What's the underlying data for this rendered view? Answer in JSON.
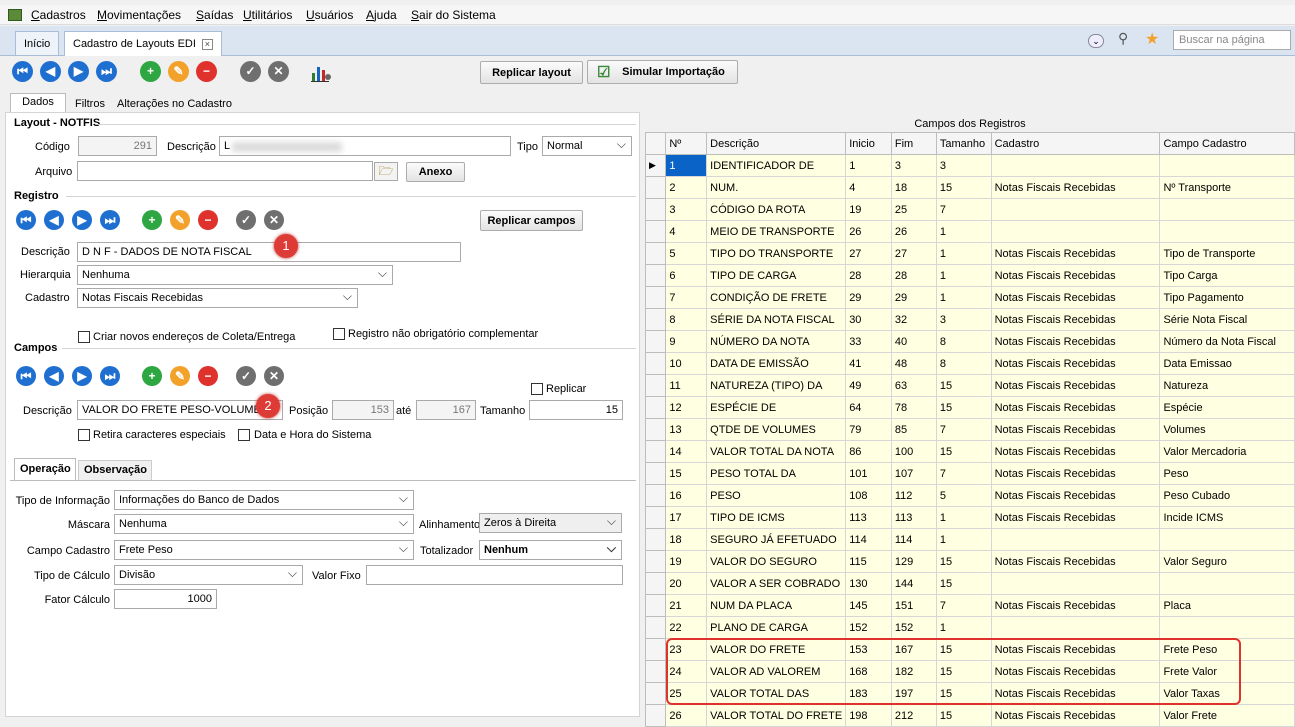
{
  "menu": [
    "Cadastros",
    "Movimentações",
    "Saídas",
    "Utilitários",
    "Usuários",
    "Ajuda",
    "Sair do Sistema"
  ],
  "tabs": {
    "home": "Início",
    "current": "Cadastro de Layouts EDI"
  },
  "search": {
    "placeholder": "Buscar na página"
  },
  "toolbar": {
    "replicar_layout": "Replicar layout",
    "simular": "Simular Importação"
  },
  "form_tabs": [
    "Dados",
    "Filtros",
    "Alterações no Cadastro"
  ],
  "layout": {
    "section": "Layout - NOTFIS",
    "codigo_label": "Código",
    "codigo": "291",
    "descricao_label": "Descrição",
    "descricao": "L",
    "tipo_label": "Tipo",
    "tipo": "Normal",
    "arquivo_label": "Arquivo",
    "arquivo": "",
    "anexo": "Anexo"
  },
  "registro": {
    "section": "Registro",
    "replicar": "Replicar campos",
    "descricao_label": "Descrição",
    "descricao": "D N F  - DADOS DE NOTA FISCAL",
    "hierarquia_label": "Hierarquia",
    "hierarquia": "Nenhuma",
    "cadastro_label": "Cadastro",
    "cadastro": "Notas Fiscais Recebidas",
    "chk1": "Criar novos endereços de Coleta/Entrega",
    "chk2": "Registro não obrigatório complementar"
  },
  "campos": {
    "section": "Campos",
    "replicar": "Replicar",
    "descricao_label": "Descrição",
    "descricao": "VALOR DO FRETE PESO-VOLUME",
    "posicao_label": "Posição",
    "posicao_ini": "153",
    "ate": "até",
    "posicao_fim": "167",
    "tamanho_label": "Tamanho",
    "tamanho": "15",
    "chk1": "Retira caracteres especiais",
    "chk2": "Data e Hora do Sistema"
  },
  "sub_tabs": [
    "Operação",
    "Observação"
  ],
  "operacao": {
    "tipo_info_label": "Tipo de Informação",
    "tipo_info": "Informações do Banco de Dados",
    "mascara_label": "Máscara",
    "mascara": "Nenhuma",
    "alinhamento_label": "Alinhamento",
    "alinhamento": "Zeros à Direita",
    "campo_cad_label": "Campo Cadastro",
    "campo_cad": "Frete Peso",
    "totalizador_label": "Totalizador",
    "totalizador": "Nenhum",
    "tipo_calc_label": "Tipo de Cálculo",
    "tipo_calc": "Divisão",
    "valor_fixo_label": "Valor Fixo",
    "valor_fixo": "",
    "fator_label": "Fator Cálculo",
    "fator": "1000"
  },
  "markers": [
    "1",
    "2"
  ],
  "grid": {
    "title": "Campos dos Registros",
    "headers": [
      "Nº",
      "Descrição",
      "Inicio",
      "Fim",
      "Tamanho",
      "Cadastro",
      "Campo Cadastro"
    ],
    "rows": [
      [
        "1",
        "IDENTIFICADOR DE",
        "1",
        "3",
        "3",
        "",
        ""
      ],
      [
        "2",
        "NUM.",
        "4",
        "18",
        "15",
        "Notas Fiscais Recebidas",
        "Nº Transporte"
      ],
      [
        "3",
        "CÓDIGO DA ROTA",
        "19",
        "25",
        "7",
        "",
        ""
      ],
      [
        "4",
        "MEIO DE TRANSPORTE",
        "26",
        "26",
        "1",
        "",
        ""
      ],
      [
        "5",
        "TIPO DO TRANSPORTE",
        "27",
        "27",
        "1",
        "Notas Fiscais Recebidas",
        "Tipo de Transporte"
      ],
      [
        "6",
        "TIPO DE CARGA",
        "28",
        "28",
        "1",
        "Notas Fiscais Recebidas",
        "Tipo Carga"
      ],
      [
        "7",
        "CONDIÇÃO DE FRETE",
        "29",
        "29",
        "1",
        "Notas Fiscais Recebidas",
        "Tipo Pagamento"
      ],
      [
        "8",
        "SÉRIE DA NOTA FISCAL",
        "30",
        "32",
        "3",
        "Notas Fiscais Recebidas",
        "Série Nota Fiscal"
      ],
      [
        "9",
        "NÚMERO DA NOTA",
        "33",
        "40",
        "8",
        "Notas Fiscais Recebidas",
        "Número da Nota Fiscal"
      ],
      [
        "10",
        "DATA DE EMISSÃO",
        "41",
        "48",
        "8",
        "Notas Fiscais Recebidas",
        "Data Emissao"
      ],
      [
        "11",
        "NATUREZA (TIPO) DA",
        "49",
        "63",
        "15",
        "Notas Fiscais Recebidas",
        "Natureza"
      ],
      [
        "12",
        "ESPÉCIE DE",
        "64",
        "78",
        "15",
        "Notas Fiscais Recebidas",
        "Espécie"
      ],
      [
        "13",
        "QTDE DE VOLUMES",
        "79",
        "85",
        "7",
        "Notas Fiscais Recebidas",
        "Volumes"
      ],
      [
        "14",
        "VALOR TOTAL DA NOTA",
        "86",
        "100",
        "15",
        "Notas Fiscais Recebidas",
        "Valor Mercadoria"
      ],
      [
        "15",
        "PESO TOTAL DA",
        "101",
        "107",
        "7",
        "Notas Fiscais Recebidas",
        "Peso"
      ],
      [
        "16",
        "PESO",
        "108",
        "112",
        "5",
        "Notas Fiscais Recebidas",
        "Peso Cubado"
      ],
      [
        "17",
        "TIPO DE ICMS",
        "113",
        "113",
        "1",
        "Notas Fiscais Recebidas",
        "Incide ICMS"
      ],
      [
        "18",
        "SEGURO JÁ EFETUADO",
        "114",
        "114",
        "1",
        "",
        ""
      ],
      [
        "19",
        "VALOR DO SEGURO",
        "115",
        "129",
        "15",
        "Notas Fiscais Recebidas",
        "Valor Seguro"
      ],
      [
        "20",
        "VALOR A SER COBRADO",
        "130",
        "144",
        "15",
        "",
        ""
      ],
      [
        "21",
        "NUM DA PLACA",
        "145",
        "151",
        "7",
        "Notas Fiscais Recebidas",
        "Placa"
      ],
      [
        "22",
        "PLANO DE CARGA",
        "152",
        "152",
        "1",
        "",
        ""
      ],
      [
        "23",
        "VALOR DO FRETE",
        "153",
        "167",
        "15",
        "Notas Fiscais Recebidas",
        "Frete Peso"
      ],
      [
        "24",
        "VALOR AD VALOREM",
        "168",
        "182",
        "15",
        "Notas Fiscais Recebidas",
        "Frete Valor"
      ],
      [
        "25",
        "VALOR TOTAL DAS",
        "183",
        "197",
        "15",
        "Notas Fiscais Recebidas",
        "Valor Taxas"
      ],
      [
        "26",
        "VALOR TOTAL DO FRETE",
        "198",
        "212",
        "15",
        "Notas Fiscais Recebidas",
        "Valor Frete"
      ]
    ]
  }
}
